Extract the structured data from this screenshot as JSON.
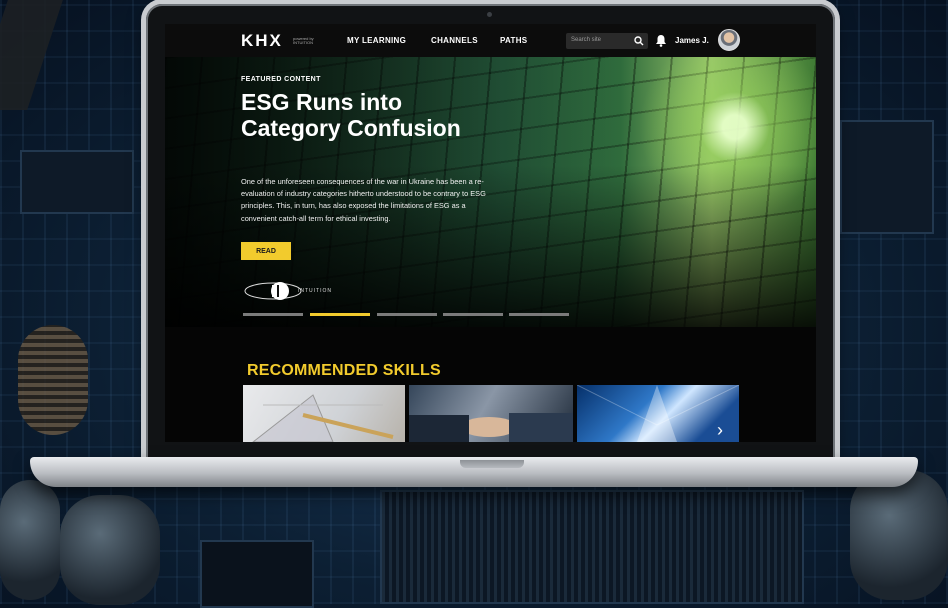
{
  "nav": {
    "logo": "KHX",
    "logo_sub": "powered by INTUITION",
    "links": [
      "MY LEARNING",
      "CHANNELS",
      "PATHS"
    ],
    "search_placeholder": "Search site",
    "user_name": "James J."
  },
  "hero": {
    "tag": "FEATURED CONTENT",
    "title": "ESG Runs into Category Confusion",
    "description": "One of the unforeseen consequences of the war in Ukraine has been a re-evaluation of industry categories hitherto understood to be contrary to ESG principles. This, in turn, has also exposed the limitations of ESG as a convenient catch-all term for ethical investing.",
    "button_label": "READ",
    "brand": "INTUITION",
    "carousel_active_index": 1,
    "carousel_count": 5
  },
  "recommended": {
    "title": "RECOMMENDED SKILLS",
    "cards": [
      "drafting-tools",
      "handshake",
      "skyscrapers"
    ]
  },
  "colors": {
    "accent": "#f2cb2d",
    "nav_bg": "#0c0c0c"
  }
}
